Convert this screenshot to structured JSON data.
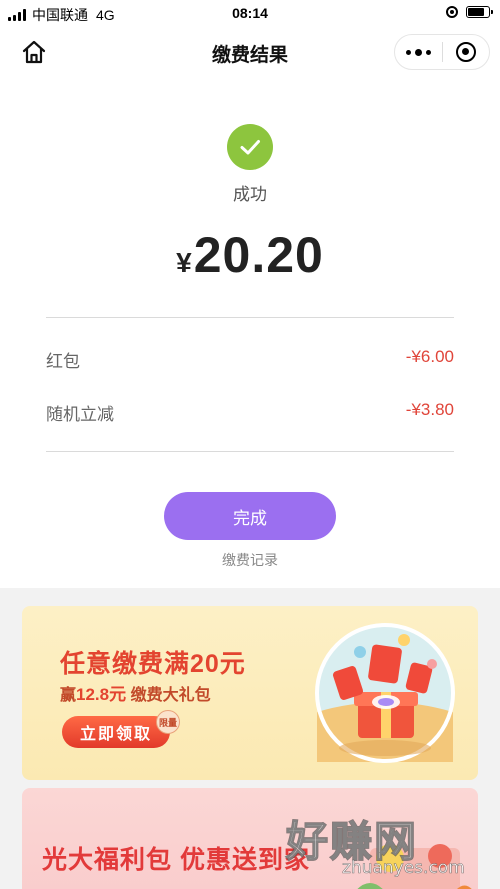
{
  "status_bar": {
    "carrier": "中国联通",
    "network": "4G",
    "time": "08:14"
  },
  "nav": {
    "title": "缴费结果",
    "home_icon": "home-icon",
    "more_icon": "more-icon",
    "close_icon": "mini-program-close-icon"
  },
  "result": {
    "status": "成功",
    "currency": "¥",
    "amount": "20.20",
    "discounts": [
      {
        "label": "红包",
        "amount": "-¥6.00"
      },
      {
        "label": "随机立减",
        "amount": "-¥3.80"
      }
    ],
    "done_label": "完成",
    "record_link": "缴费记录"
  },
  "promo1": {
    "title": "任意缴费满20元",
    "sub_prefix": "赢",
    "sub_highlight": "12.8元",
    "sub_suffix": "缴费大礼包",
    "button": "立即领取",
    "tag": "限量"
  },
  "promo2": {
    "title": "光大福利包 优惠送到家"
  },
  "watermark": {
    "big": "好赚网",
    "small": "zhuanyes.com"
  },
  "colors": {
    "accent_purple": "#9b6ff0",
    "success_green": "#8dc53e",
    "discount_red": "#e0453a"
  }
}
